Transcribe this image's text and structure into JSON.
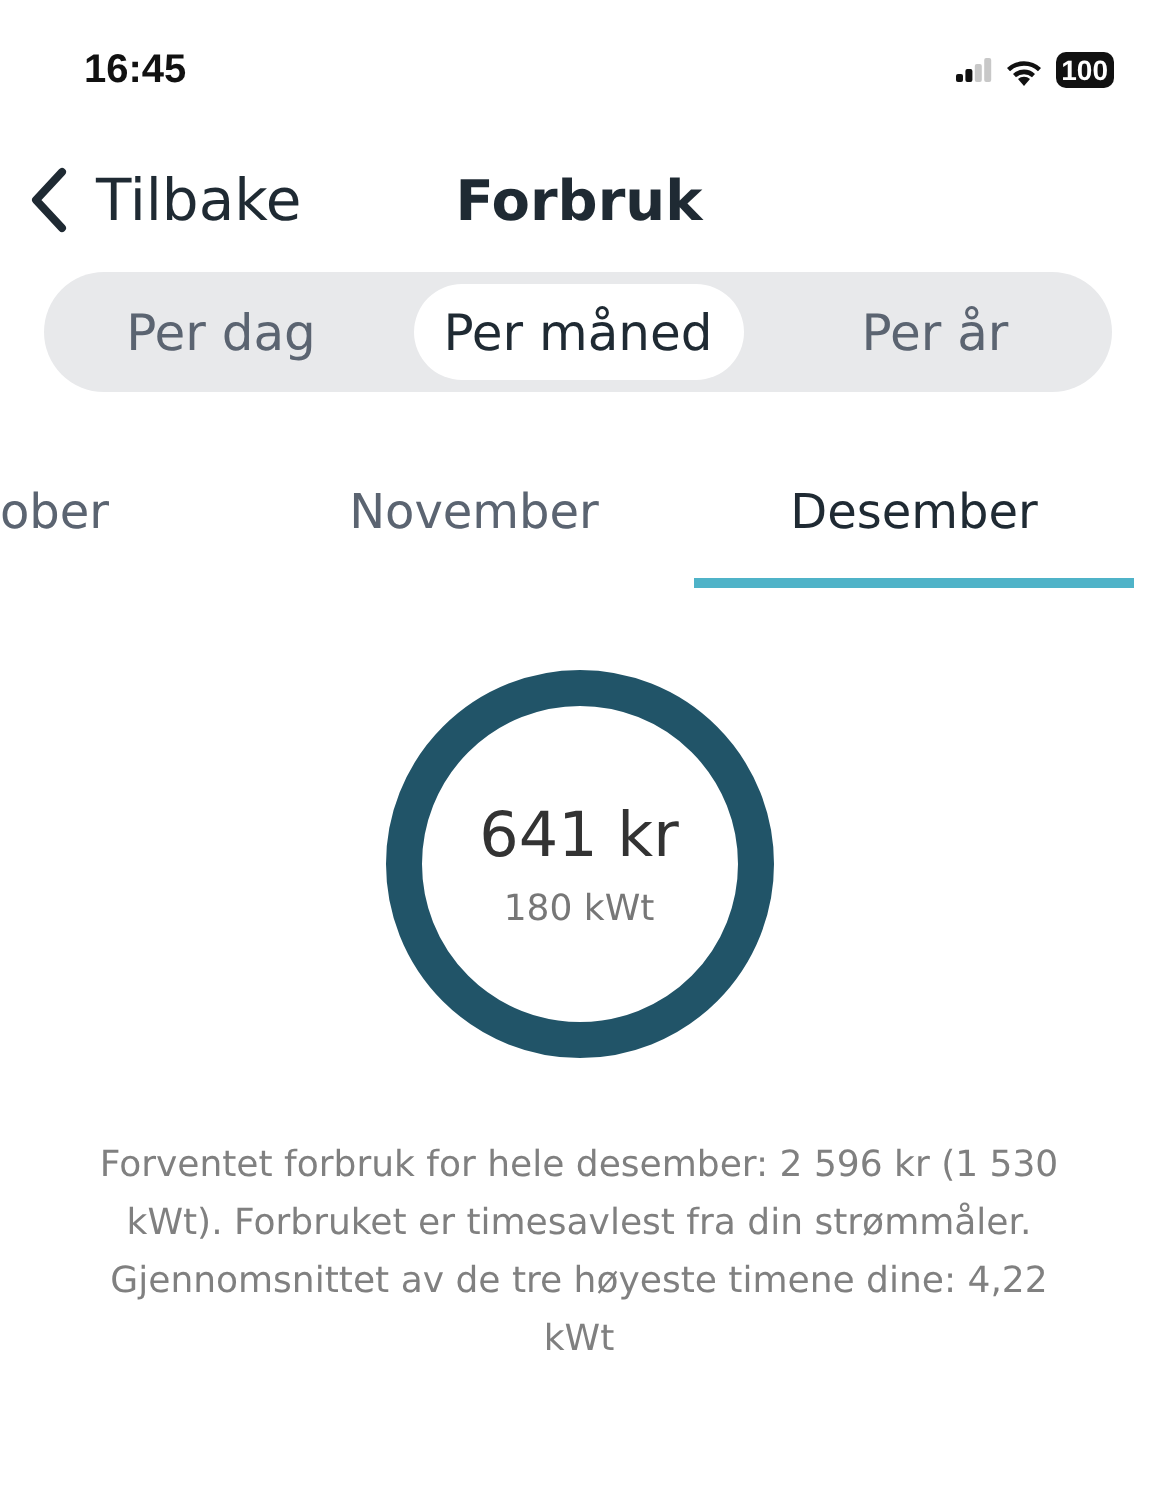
{
  "status_bar": {
    "time": "16:45",
    "battery": "100"
  },
  "header": {
    "back": "Tilbake",
    "title": "Forbruk"
  },
  "period_tabs": [
    {
      "label": "Per dag",
      "selected": false
    },
    {
      "label": "Per måned",
      "selected": true
    },
    {
      "label": "Per år",
      "selected": false
    }
  ],
  "month_tabs": [
    {
      "label": "ober",
      "selected": false
    },
    {
      "label": "November",
      "selected": false
    },
    {
      "label": "Desember",
      "selected": true
    }
  ],
  "summary": {
    "amount": "641 kr",
    "energy": "180 kWt"
  },
  "notes": [
    "Forventet forbruk for hele desember: 2 596 kr (1 530 kWt). Forbruket er timesavlest fra din strømmåler.",
    "Gjennomsnittet av de tre høyeste timene dine: 4,22 kWt"
  ]
}
